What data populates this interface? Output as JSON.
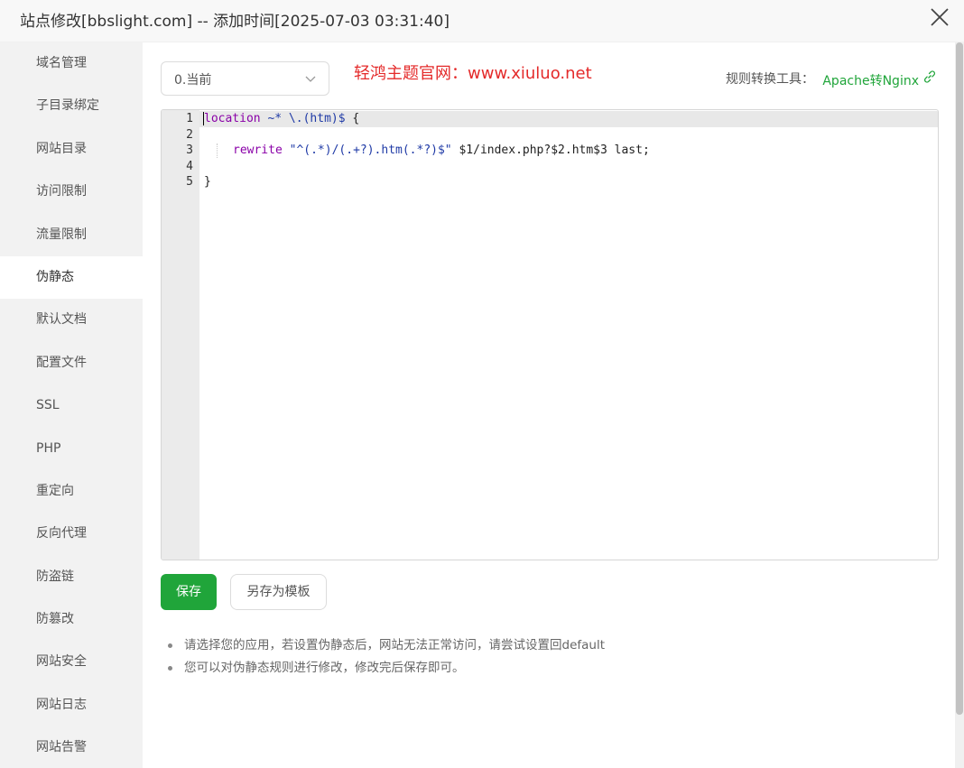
{
  "window": {
    "title": "站点修改[bbslight.com] -- 添加时间[2025-07-03 03:31:40]"
  },
  "sidebar": {
    "items": [
      {
        "label": "域名管理"
      },
      {
        "label": "子目录绑定"
      },
      {
        "label": "网站目录"
      },
      {
        "label": "访问限制"
      },
      {
        "label": "流量限制"
      },
      {
        "label": "伪静态",
        "active": true
      },
      {
        "label": "默认文档"
      },
      {
        "label": "配置文件"
      },
      {
        "label": "SSL"
      },
      {
        "label": "PHP"
      },
      {
        "label": "重定向"
      },
      {
        "label": "反向代理"
      },
      {
        "label": "防盗链"
      },
      {
        "label": "防篡改"
      },
      {
        "label": "网站安全"
      },
      {
        "label": "网站日志"
      },
      {
        "label": "网站告警"
      }
    ]
  },
  "main": {
    "template_select": {
      "value": "0.当前"
    },
    "promo_text": "轻鸿主题官网：www.xiuluo.net",
    "tool_label": "规则转换工具：",
    "tool_link": "Apache转Nginx",
    "editor": {
      "line_numbers": [
        "1",
        "2",
        "3",
        "4",
        "5"
      ],
      "lines": {
        "l1_kw": "location",
        "l1_op": " ~* \\.(htm)$ ",
        "l1_brace": "{",
        "l3_kw": "rewrite",
        "l3_str": " \"^(.*)/(.+?).htm(.*?)$\"",
        "l3_rest": " $1/index.php?$2.htm$3 last;",
        "l5": "}"
      }
    },
    "buttons": {
      "save": "保存",
      "save_template": "另存为模板"
    },
    "tips": [
      "请选择您的应用，若设置伪静态后，网站无法正常访问，请尝试设置回default",
      "您可以对伪静态规则进行修改，修改完后保存即可。"
    ]
  },
  "colors": {
    "accent_green": "#20a53a",
    "promo_red": "#e42a2a"
  }
}
